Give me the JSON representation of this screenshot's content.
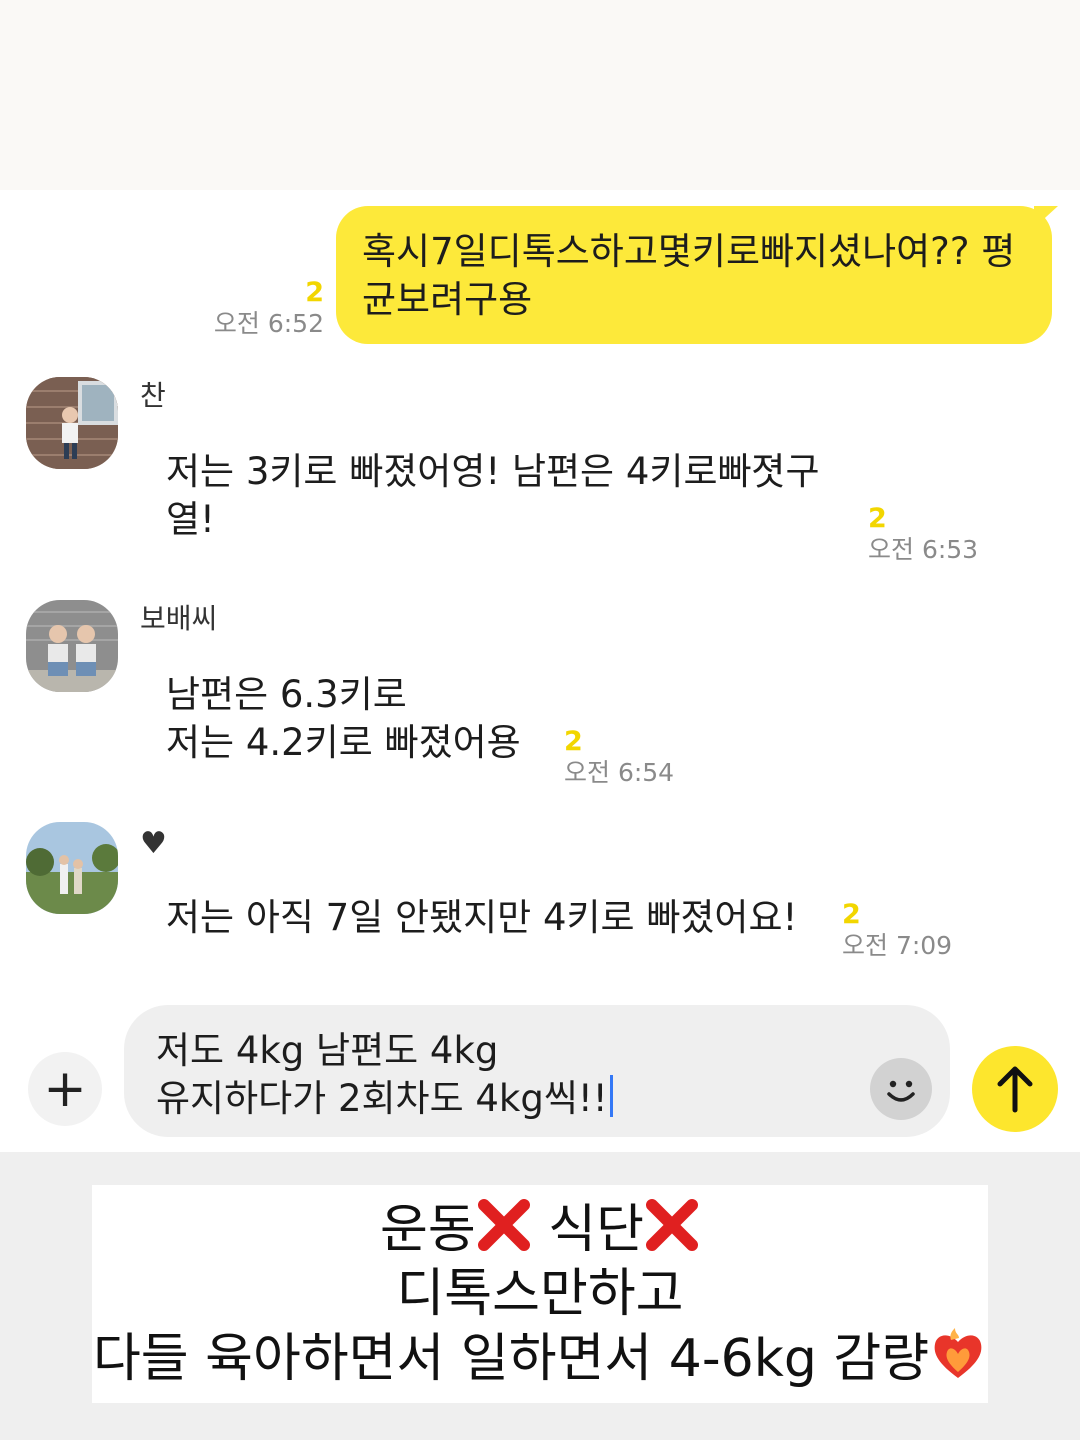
{
  "messages": {
    "outgoing": {
      "text_line1": "혹시7일디톡스하고몇키로빠지셨나여?? 평",
      "text_line2": "균보려구용",
      "unread": "2",
      "time": "오전 6:52"
    },
    "incoming": [
      {
        "sender": "찬",
        "line1": "저는 3키로 빠졌어영! 남편은 4키로빠졋구",
        "line2": "열!",
        "unread": "2",
        "time": "오전 6:53"
      },
      {
        "sender": "보배씨",
        "line1": "남편은 6.3키로",
        "line2": "저는 4.2키로 빠졌어용",
        "unread": "2",
        "time": "오전 6:54"
      },
      {
        "sender": "♥",
        "line1": "저는 아직 7일 안됐지만 4키로 빠졌어요!",
        "unread": "2",
        "time": "오전 7:09"
      }
    ]
  },
  "composer": {
    "plus_symbol": "+",
    "line1": "저도 4kg 남편도 4kg",
    "line2": "유지하다가 2회차도 4kg씩!!",
    "emoji_icon": "smiley-icon",
    "send_icon": "arrow-up-icon"
  },
  "caption": {
    "line1_a": "운동",
    "line1_b": "식단",
    "line2": "디톡스만하고",
    "line3": "다들 육아하면서 일하면서 4-6kg 감량",
    "x_icon": "red-x-icon",
    "end_icon": "fire-heart-icon"
  },
  "colors": {
    "bubble": "#fde93a",
    "unread": "#f2d600",
    "send_button": "#fde62d",
    "x_mark": "#e02020"
  }
}
